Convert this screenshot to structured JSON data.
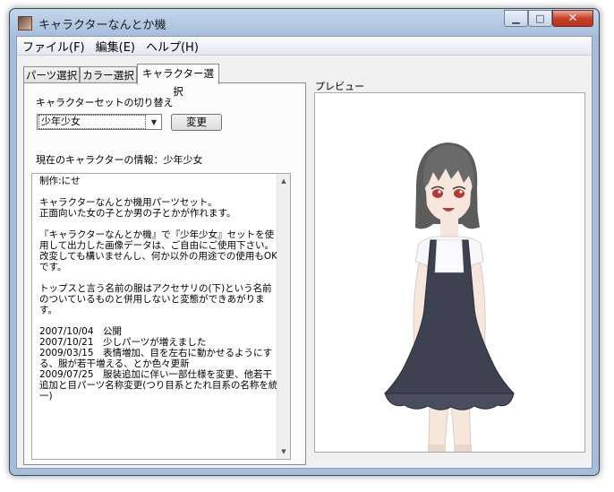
{
  "window": {
    "title": "キャラクターなんとか機",
    "minimize_glyph": "▁",
    "maximize_glyph": "□",
    "close_glyph": "✕"
  },
  "menu": [
    {
      "label": "ファイル(F)"
    },
    {
      "label": "編集(E)"
    },
    {
      "label": "ヘルプ(H)"
    }
  ],
  "tabs": [
    {
      "label": "パーツ選択",
      "active": false
    },
    {
      "label": "カラー選択",
      "active": false
    },
    {
      "label": "キャラクター選択",
      "active": true
    }
  ],
  "panel": {
    "switch_label": "キャラクターセットの切り替え",
    "select_value": "少年少女",
    "select_arrow": "▼",
    "change_button": "変更",
    "info_label": "現在のキャラクターの情報：少年少女",
    "info_text": "制作:にせ\n\nキャラクターなんとか機用パーツセット。\n正面向いた女の子とか男の子とかが作れます。\n\n『キャラクターなんとか機』で『少年少女』セットを使用して出力した画像データは、ご自由にご使用下さい。\n改変しても構いませんし、何か以外の用途での使用もOKです。\n\nトップスと言う名前の服はアクセサリの(下)という名前のついているものと併用しないと変態ができあがります。\n\n2007/10/04　公開\n2007/10/21　少しパーツが増えました\n2009/03/15　表情増加、目を左右に動かせるようにする、服が若干増える、とか色々更新\n2009/07/25　服装追加に伴い一部仕様を変更、他若干追加と目パーツ名称変更(つり目系とたれ目系の名称を統一)"
  },
  "preview": {
    "label": "プレビュー"
  },
  "colors": {
    "hair": "#5c5c5c",
    "dress": "#3e4150",
    "skin": "#f6e6dc",
    "eyes": "#b33a3a"
  }
}
